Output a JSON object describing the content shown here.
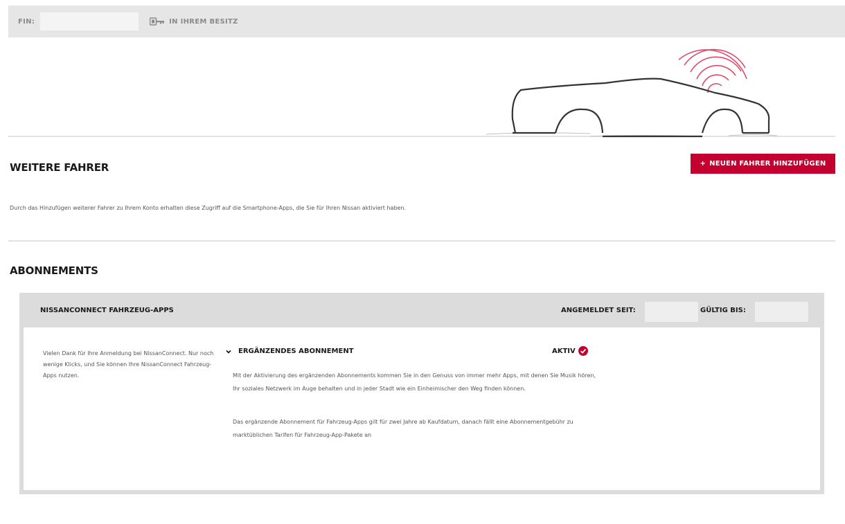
{
  "topbar": {
    "fin_label": "FIN:",
    "fin_value": "",
    "owner_icon": "key-icon",
    "owner_label": "IN IHREM BESITZ"
  },
  "drivers": {
    "title": "WEITERE FAHRER",
    "add_button": "NEUEN FAHRER HINZUFÜGEN",
    "add_icon": "+",
    "description": "Durch das Hinzufügen weiterer Fahrer zu Ihrem Konto erhalten diese Zugriff auf die Smartphone-Apps, die Sie für Ihren Nissan aktiviert haben."
  },
  "subscriptions": {
    "title": "ABONNEMENTS",
    "card": {
      "title": "NISSANCONNECT FAHRZEUG-APPS",
      "since_label": "ANGEMELDET SEIT:",
      "since_value": "",
      "valid_label": "GÜLTIG BIS:",
      "valid_value": "",
      "thanks": "Vielen Dank für Ihre Anmeldung bei NissanConnect. Nur noch wenige Klicks, und Sie können Ihre NissanConnect Fahrzeug-Apps nutzen.",
      "plan_title": "ERGÄNZENDES ABONNEMENT",
      "status": "AKTIV",
      "status_icon": "check-circle-icon",
      "description_1": "Mit der Aktivierung des ergänzenden Abonnements kommen Sie in den Genuss von immer mehr Apps, mit denen Sie Musik hören, Ihr soziales Netzwerk im Auge behalten und in jeder Stadt wie ein Einheimischer den Weg finden können.",
      "description_2": "Das ergänzende Abonnement für Fahrzeug-Apps gilt für zwei Jahre ab Kaufdatum, danach fällt eine Abonnementgebühr zu marktüblichen Tarifen für Fahrzeug-App-Pakete an"
    }
  },
  "colors": {
    "accent": "#c3002f",
    "panel": "#dcdcdc",
    "topbar": "#e6e6e6"
  }
}
